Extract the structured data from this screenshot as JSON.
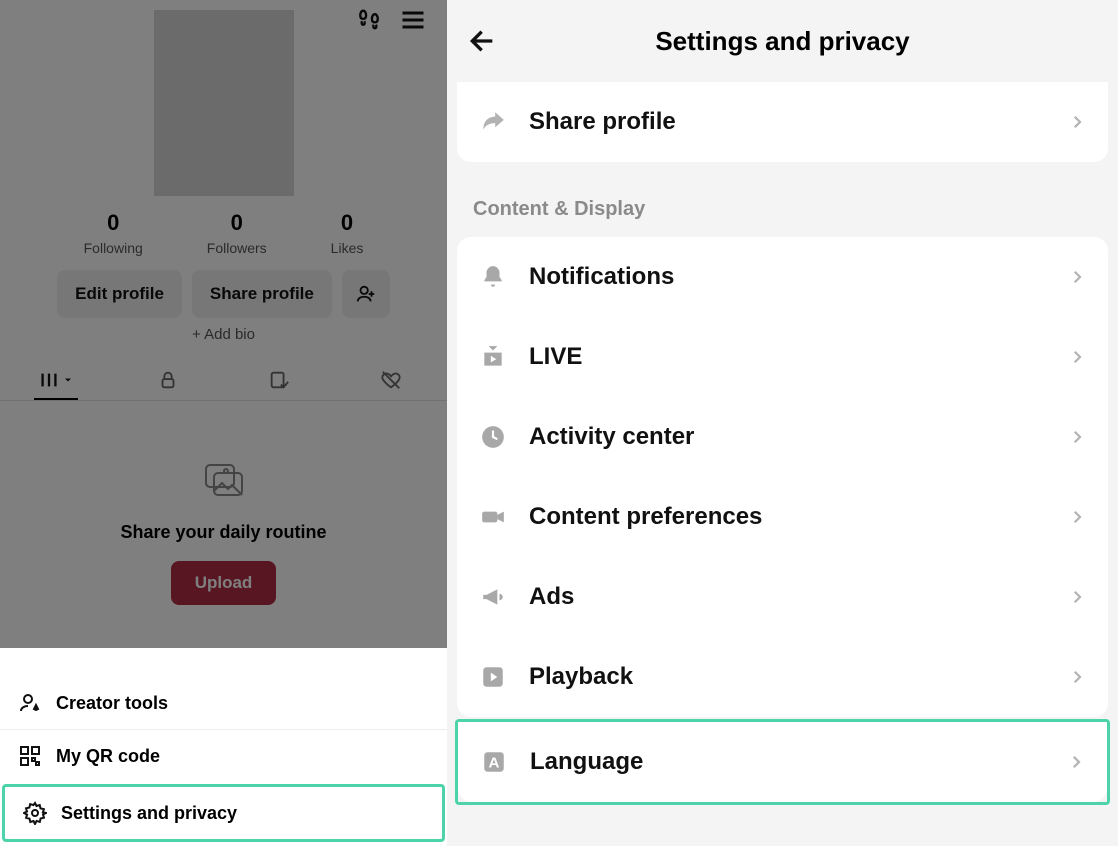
{
  "left": {
    "stats": {
      "following": {
        "value": "0",
        "label": "Following"
      },
      "followers": {
        "value": "0",
        "label": "Followers"
      },
      "likes": {
        "value": "0",
        "label": "Likes"
      }
    },
    "buttons": {
      "edit": "Edit profile",
      "share": "Share profile"
    },
    "addbio": "+ Add bio",
    "empty": {
      "text": "Share your daily routine",
      "upload": "Upload"
    },
    "sheet": {
      "creator": "Creator tools",
      "qr": "My QR code",
      "settings": "Settings and privacy"
    }
  },
  "right": {
    "title": "Settings and privacy",
    "topcard": {
      "share": "Share profile"
    },
    "section": "Content & Display",
    "items": {
      "notifications": "Notifications",
      "live": "LIVE",
      "activity": "Activity center",
      "content": "Content preferences",
      "ads": "Ads",
      "playback": "Playback",
      "language": "Language"
    }
  }
}
